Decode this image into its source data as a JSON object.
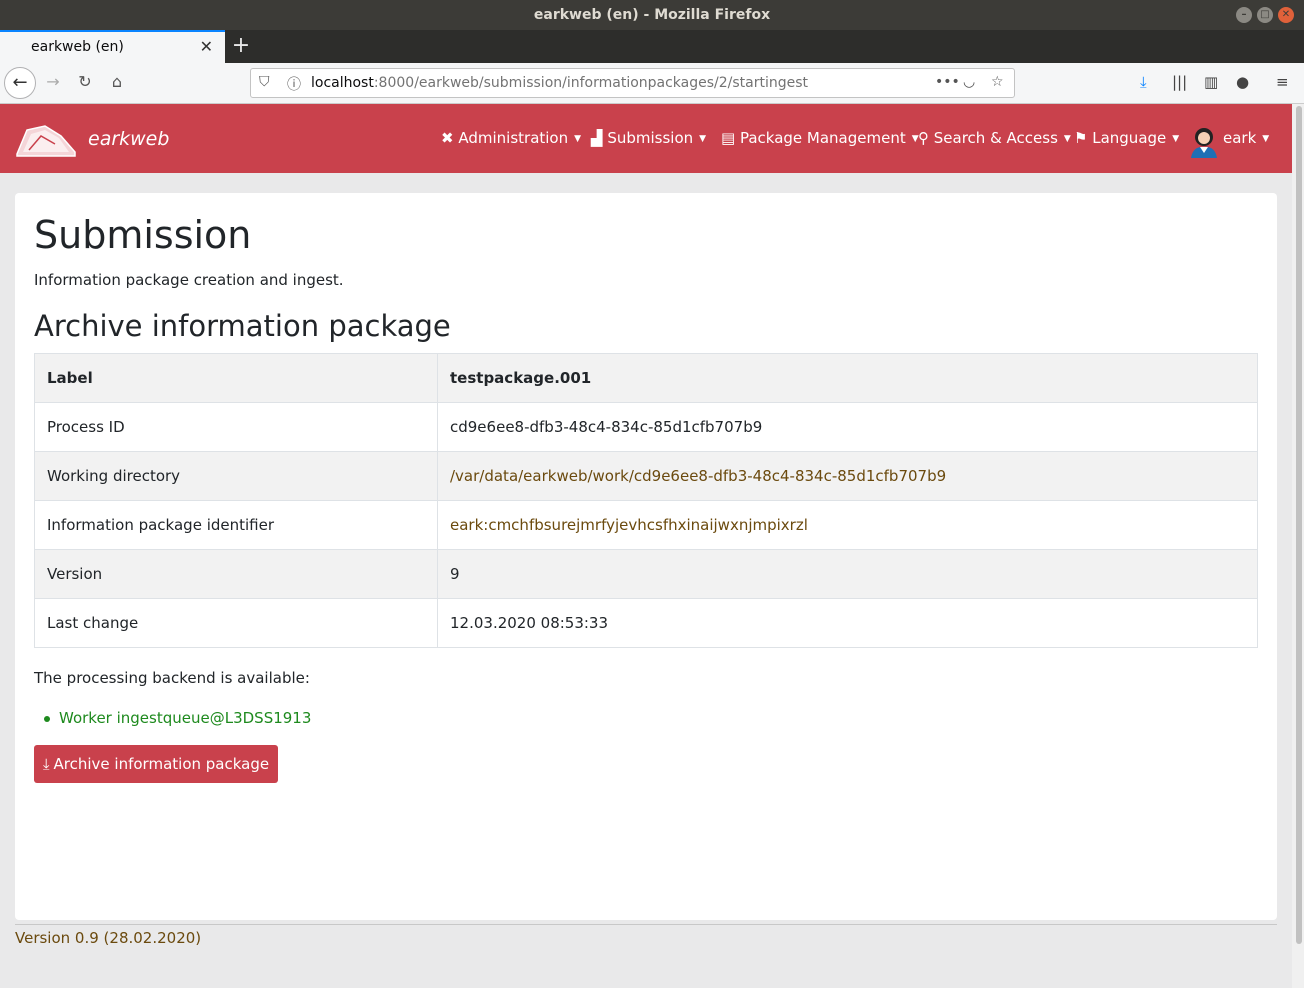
{
  "window": {
    "title": "earkweb (en) - Mozilla Firefox"
  },
  "browser": {
    "tab_title": "earkweb (en)",
    "url_host": "localhost",
    "url_rest": ":8000/earkweb/submission/informationpackages/2/startingest"
  },
  "app": {
    "brand": "earkweb",
    "menu": {
      "administration": "Administration",
      "submission": "Submission",
      "package_management": "Package Management",
      "search_access": "Search & Access",
      "language": "Language",
      "user": "eark"
    },
    "accent_color": "#c9414c"
  },
  "page": {
    "title": "Submission",
    "lead": "Information package creation and ingest.",
    "section_title": "Archive information package",
    "table": {
      "rows": [
        {
          "label": "Label",
          "value": "testpackage.001"
        },
        {
          "label": "Process ID",
          "value": "cd9e6ee8-dfb3-48c4-834c-85d1cfb707b9"
        },
        {
          "label": "Working directory",
          "value": "/var/data/earkweb/work/cd9e6ee8-dfb3-48c4-834c-85d1cfb707b9"
        },
        {
          "label": "Information package identifier",
          "value": "eark:cmchfbsurejmrfyjevhcsfhxinaijwxnjmpixrzl"
        },
        {
          "label": "Version",
          "value": "9"
        },
        {
          "label": "Last change",
          "value": "12.03.2020 08:53:33"
        }
      ]
    },
    "backend_status": "The processing backend is available:",
    "worker": "Worker ingestqueue@L3DSS1913",
    "archive_button": "Archive information package"
  },
  "footer": {
    "version": "Version 0.9 (28.02.2020)"
  }
}
